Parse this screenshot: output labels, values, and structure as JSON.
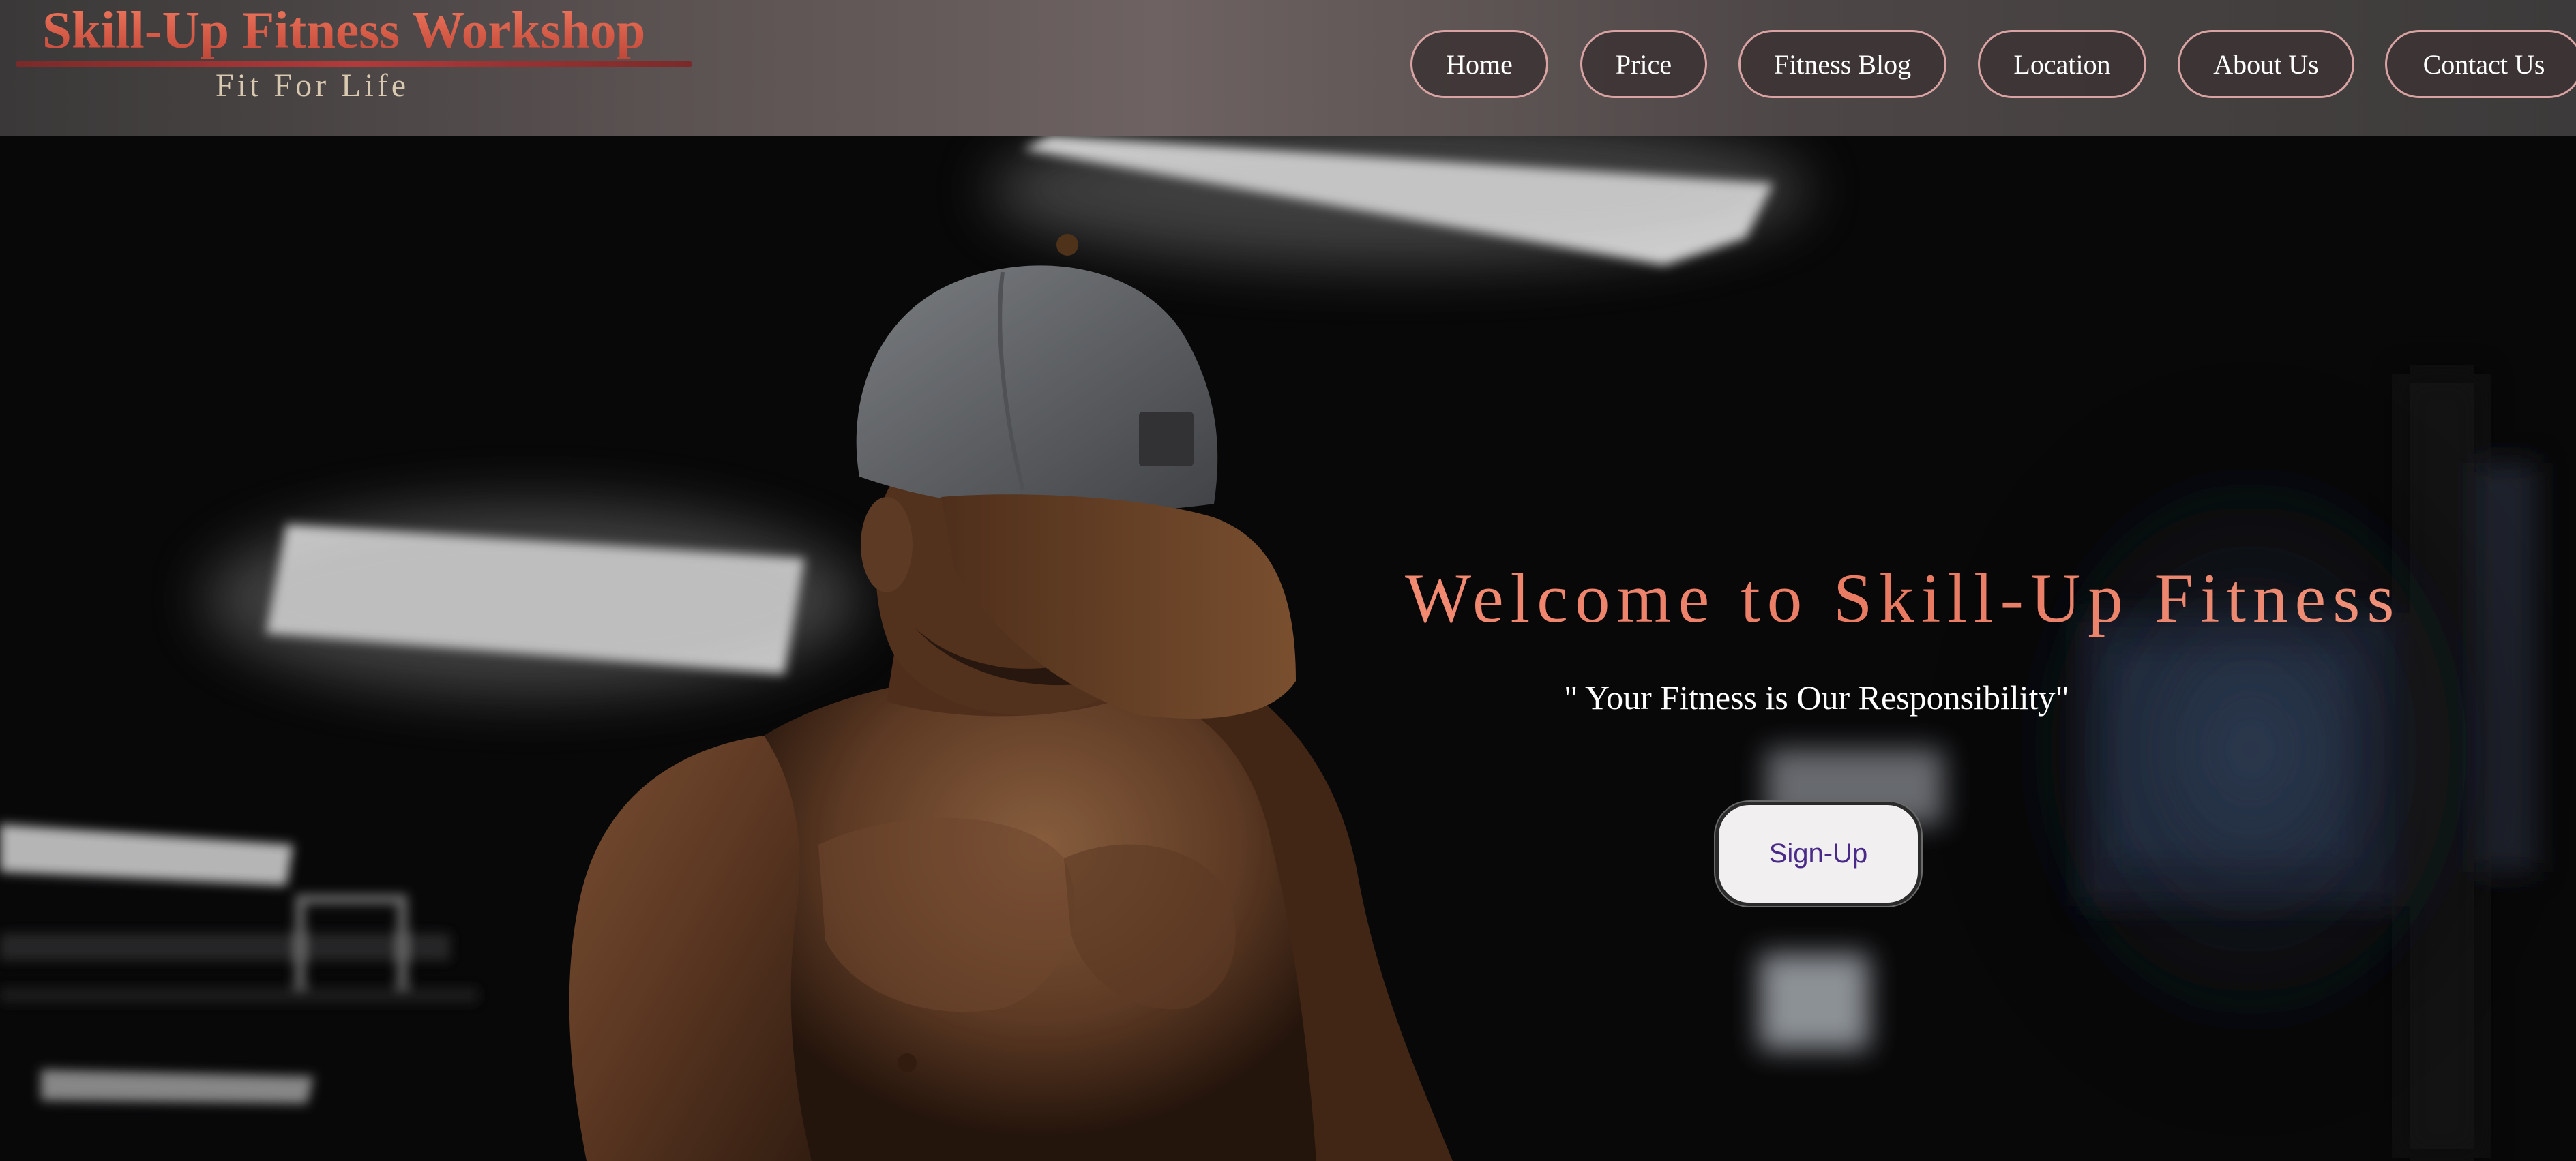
{
  "header": {
    "brand_title": "Skill-Up Fitness Workshop",
    "brand_tagline": "Fit For Life",
    "nav": [
      {
        "label": "Home"
      },
      {
        "label": "Price"
      },
      {
        "label": "Fitness Blog"
      },
      {
        "label": "Location"
      },
      {
        "label": "About Us"
      },
      {
        "label": "Contact Us"
      }
    ]
  },
  "hero": {
    "title": "Welcome to Skill-Up Fitness",
    "slogan": "\" Your Fitness is Our Responsibility\"",
    "signup_label": "Sign-Up",
    "background_image": "man-in-cap-gym-photo"
  },
  "colors": {
    "brand_accent": "#e06a54",
    "title_accent": "#ee8470",
    "nav_border": "#d9a3a3",
    "button_text": "#4a2a88"
  }
}
